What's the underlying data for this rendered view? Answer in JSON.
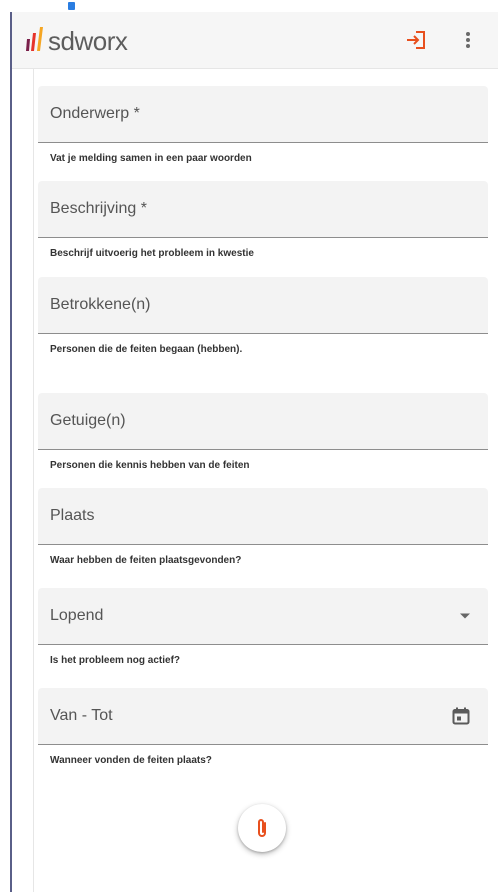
{
  "app": {
    "logo_text": "sdworx",
    "colors": {
      "logo_bar_dark": "#7a1f4a",
      "logo_bar_red": "#e6342b",
      "logo_bar_orange": "#f5a623",
      "accent": "#e8501e"
    }
  },
  "header": {
    "logout_icon": "logout-icon",
    "menu_icon": "more-vert-icon"
  },
  "form": {
    "fields": [
      {
        "label": "Onderwerp *",
        "hint": "Vat je melding samen in een paar woorden"
      },
      {
        "label": "Beschrijving *",
        "hint": "Beschrijf uitvoerig het probleem in kwestie"
      },
      {
        "label": "Betrokkene(n)",
        "hint": "Personen die de feiten begaan (hebben)."
      },
      {
        "label": "Getuige(n)",
        "hint": "Personen die kennis hebben van de feiten"
      },
      {
        "label": "Plaats",
        "hint": "Waar hebben de feiten plaatsgevonden?"
      },
      {
        "label": "Lopend",
        "hint": "Is het probleem nog actief?",
        "icon": "dropdown-arrow-icon"
      },
      {
        "label": "Van - Tot",
        "hint": "Wanneer vonden de feiten plaats?",
        "icon": "calendar-icon"
      }
    ]
  },
  "attach_button": {
    "icon": "paperclip-icon"
  }
}
